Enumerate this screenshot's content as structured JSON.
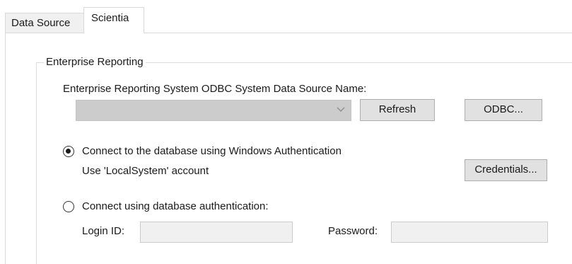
{
  "tabs": [
    {
      "label": "Data Source",
      "active": false
    },
    {
      "label": "Scientia",
      "active": true
    }
  ],
  "group": {
    "title": "Enterprise Reporting",
    "dsn_label": "Enterprise Reporting System ODBC System Data Source Name:",
    "dsn_value": "",
    "refresh_label": "Refresh",
    "odbc_label": "ODBC...",
    "auth_windows_label": "Connect to the database using Windows Authentication",
    "auth_windows_selected": true,
    "account_text": "Use 'LocalSystem' account",
    "credentials_label": "Credentials...",
    "auth_db_label": "Connect using database authentication:",
    "auth_db_selected": false,
    "login_label": "Login ID:",
    "login_value": "",
    "password_label": "Password:",
    "password_value": ""
  },
  "colors": {
    "disabled_field": "#cccccc",
    "button_face": "#e1e1e1",
    "border": "#d9d9d9"
  }
}
